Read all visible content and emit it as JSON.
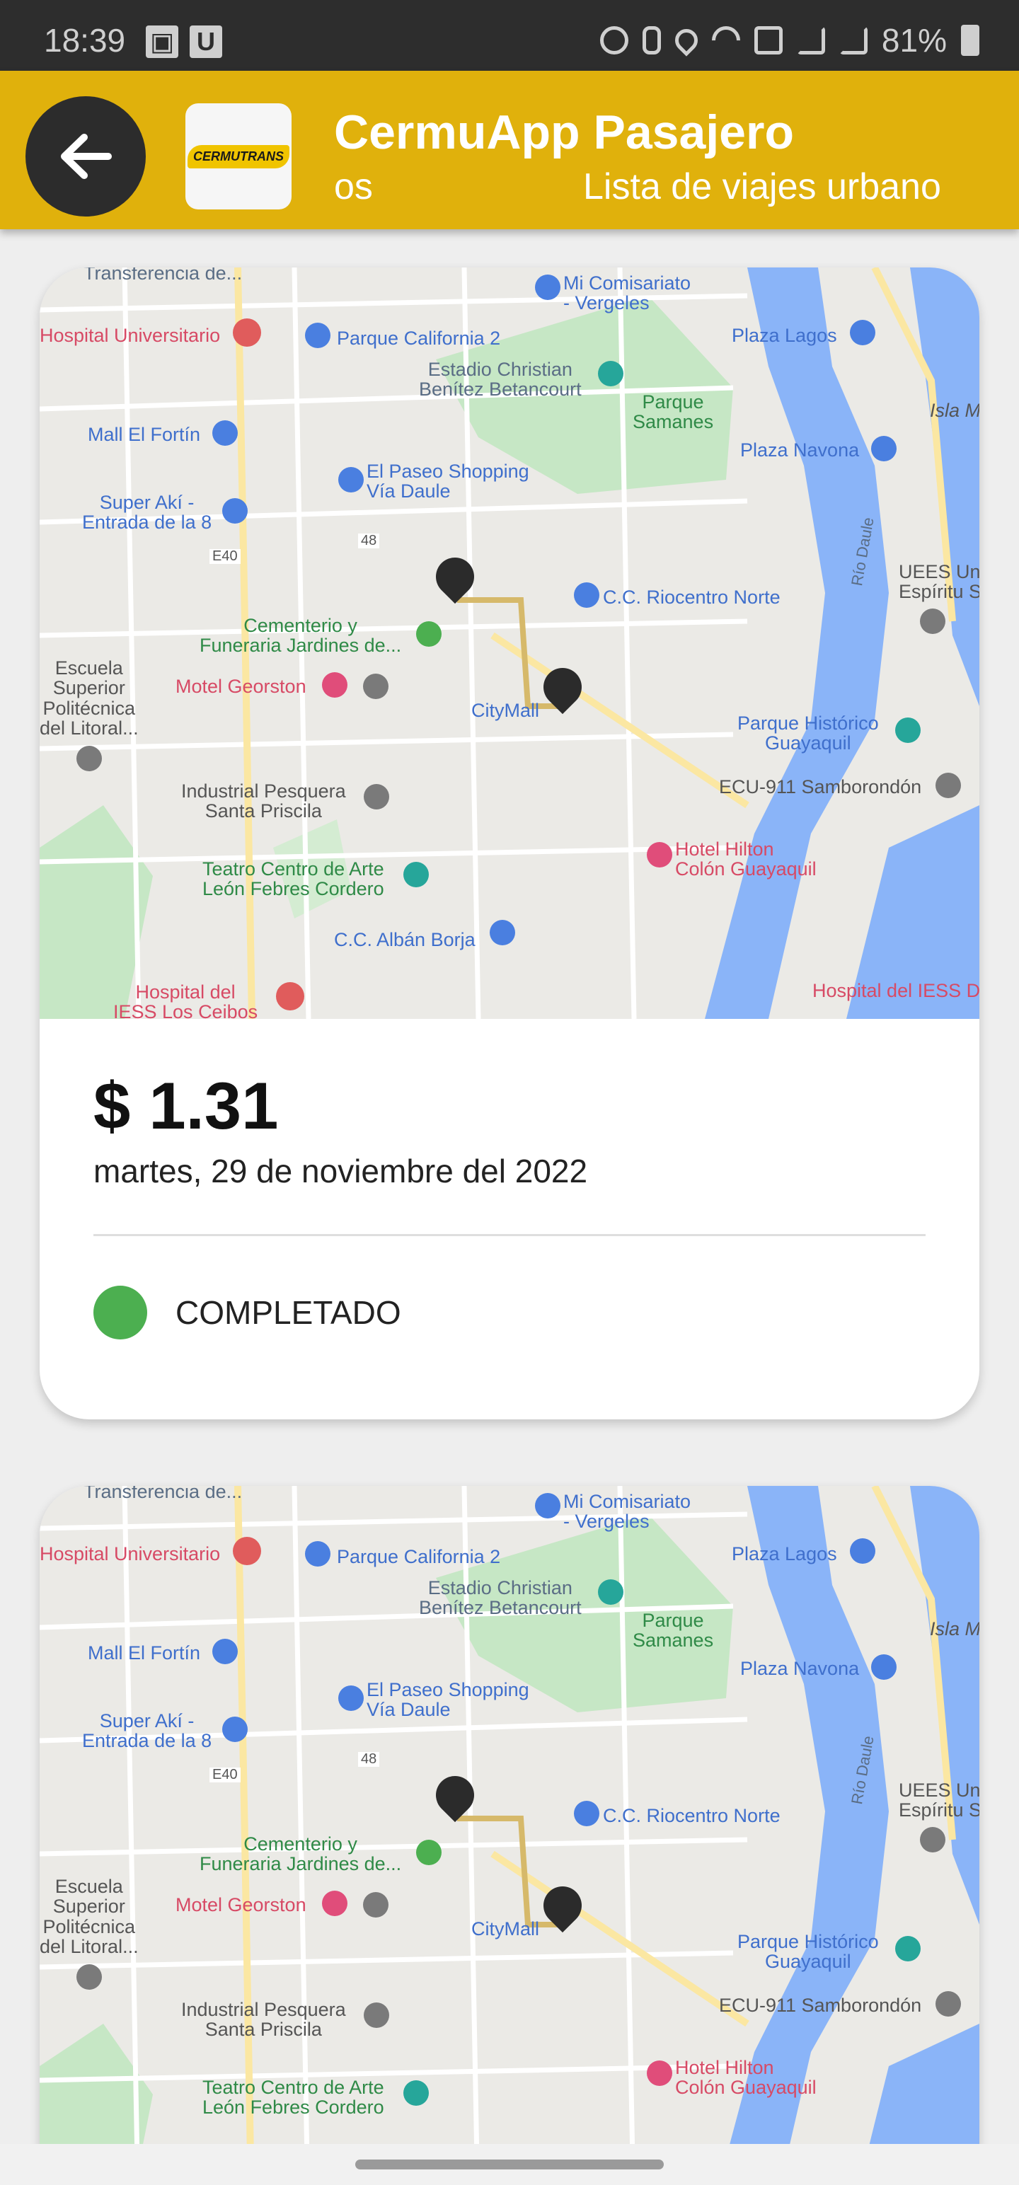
{
  "status_bar": {
    "time": "18:39",
    "battery": "81%",
    "left_icons": [
      "image-icon",
      "u-app-icon"
    ],
    "right_icons": [
      "alarm-icon",
      "bluetooth-icon",
      "location-icon",
      "wifi-icon",
      "volte-4g-icon",
      "signal-icon",
      "signal-icon",
      "battery-icon"
    ]
  },
  "app_bar": {
    "back_icon": "arrow-back-icon",
    "logo_text": "CERMUTRANS",
    "title": "CermuApp Pasajero",
    "subtitle_tail": "os",
    "subtitle": "Lista de viajes urbano",
    "color": "#e0b10c"
  },
  "trips": [
    {
      "price": "$ 1.31",
      "date": "martes, 29 de noviembre del 2022",
      "status": "COMPLETADO",
      "status_color": "#4caf50"
    }
  ],
  "map_labels": {
    "transferencia": "Transferencia de...",
    "comisariato": "Mi Comisariato\n- Vergeles",
    "hospital_univ": "Hospital Universitario",
    "parque_california": "Parque California 2",
    "plaza_lagos": "Plaza Lagos",
    "estadio": "Estadio Christian\nBenítez Betancourt",
    "parque_samanes": "Parque\nSamanes",
    "isla": "Isla M",
    "mall_fortin": "Mall El Fortín",
    "plaza_navona": "Plaza Navona",
    "paseo_shopping": "El Paseo Shopping\nVía Daule",
    "super_aki": "Super Akí -\nEntrada de la 8",
    "e40": "E40",
    "r48": "48",
    "rio_daule": "Río Daule",
    "uees": "UEES Uni\nEspíritu S",
    "riocentro": "C.C. Riocentro Norte",
    "cementerio": "Cementerio y\nFuneraria Jardines de...",
    "escuela": "Escuela\nSuperior\nPolitécnica\ndel Litoral...",
    "motel": "Motel Georston",
    "citymall": "CityMall",
    "parque_historico": "Parque Histórico\nGuayaquil",
    "industrial": "Industrial Pesquera\nSanta Priscila",
    "ecu911": "ECU-911 Samborondón",
    "hilton": "Hotel Hilton\nColón Guayaquil",
    "teatro": "Teatro Centro de Arte\nLeón Febres Cordero",
    "alban_borja": "C.C. Albán Borja",
    "hospital_ceibos": "Hospital del\nIESS Los Ceibos",
    "hospital_iess": "Hospital del IESS D"
  }
}
